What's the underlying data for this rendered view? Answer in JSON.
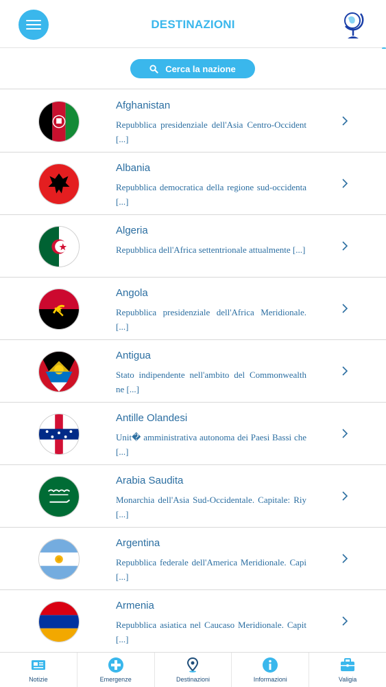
{
  "header": {
    "title": "DESTINAZIONI",
    "menu_icon": "hamburger-menu-icon",
    "globe_icon": "globe-icon"
  },
  "search": {
    "label": "Cerca la nazione",
    "icon": "search-icon"
  },
  "countries": [
    {
      "name": "Afghanistan",
      "description": "Repubblica presidenziale dell'Asia Centro-Occident [...]",
      "flag": "afghanistan-flag"
    },
    {
      "name": "Albania",
      "description": "Repubblica democratica della regione sud-occidenta [...]",
      "flag": "albania-flag"
    },
    {
      "name": "Algeria",
      "description": "Repubblica dell'Africa settentrionale attualmente [...]",
      "flag": "algeria-flag"
    },
    {
      "name": "Angola",
      "description": "Repubblica presidenziale dell'Africa Meridionale. [...]",
      "flag": "angola-flag"
    },
    {
      "name": "Antigua",
      "description": "Stato indipendente nell'ambito del Commonwealth ne [...]",
      "flag": "antigua-flag"
    },
    {
      "name": "Antille Olandesi",
      "description": "Unit� amministrativa autonoma dei Paesi Bassi che [...]",
      "flag": "netherlands-antilles-flag"
    },
    {
      "name": "Arabia Saudita",
      "description": "Monarchia dell'Asia Sud-Occidentale. Capitale: Riy [...]",
      "flag": "saudi-arabia-flag"
    },
    {
      "name": "Argentina",
      "description": "Repubblica federale dell'America Meridionale. Capi [...]",
      "flag": "argentina-flag"
    },
    {
      "name": "Armenia",
      "description": "Repubblica asiatica nel Caucaso Meridionale. Capit [...]",
      "flag": "armenia-flag"
    }
  ],
  "tabs": [
    {
      "label": "Notizie",
      "icon": "news-icon"
    },
    {
      "label": "Emergenze",
      "icon": "plus-circle-icon"
    },
    {
      "label": "Destinazioni",
      "icon": "map-pin-icon"
    },
    {
      "label": "Informazioni",
      "icon": "info-icon"
    },
    {
      "label": "Valigia",
      "icon": "suitcase-icon"
    }
  ],
  "colors": {
    "accent": "#3ab7ec",
    "text": "#2b6ea1",
    "tab_text": "#1f4e7a"
  }
}
